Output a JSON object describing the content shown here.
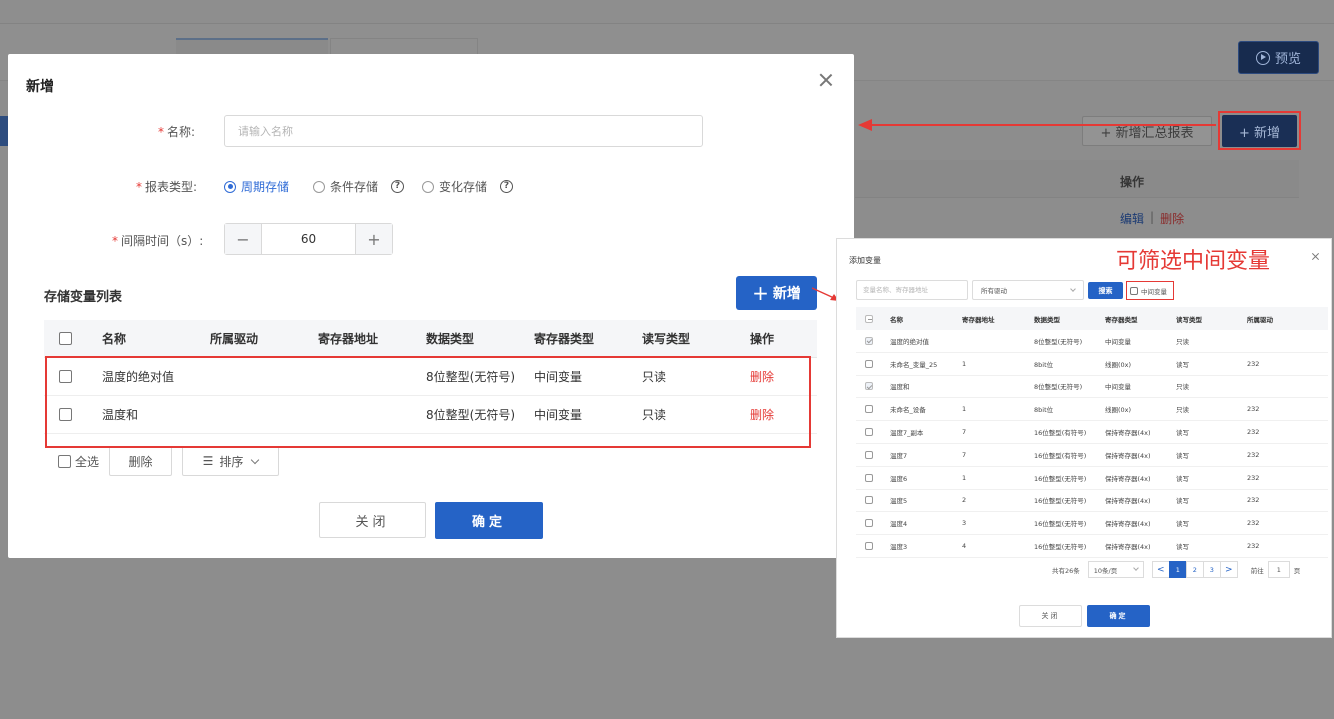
{
  "background": {
    "preview_button": "预览",
    "summary_button": "+ 新增汇总报表",
    "add_button": "+ 新增",
    "table_header_op": "操作",
    "row_edit": "编辑",
    "row_sep": "|",
    "row_delete": "删除"
  },
  "modal": {
    "title": "新增",
    "form": {
      "name_label": "名称:",
      "name_placeholder": "请输入名称",
      "type_label": "报表类型:",
      "type_options": [
        "周期存储",
        "条件存储",
        "变化存储"
      ],
      "type_selected": "周期存储",
      "help_icon_glyph": "?",
      "interval_label": "间隔时间（s）:",
      "interval_value": "60",
      "minus_glyph": "−",
      "plus_glyph": "+"
    },
    "var_section_title": "存储变量列表",
    "add_var_button": "新增",
    "table": {
      "headers": [
        "名称",
        "所属驱动",
        "寄存器地址",
        "数据类型",
        "寄存器类型",
        "读写类型",
        "操作"
      ],
      "rows": [
        {
          "name": "温度的绝对值",
          "driver": "",
          "address": "",
          "data_type": "8位整型(无符号)",
          "reg_type": "中间变量",
          "rw": "只读",
          "op": "删除"
        },
        {
          "name": "温度和",
          "driver": "",
          "address": "",
          "data_type": "8位整型(无符号)",
          "reg_type": "中间变量",
          "rw": "只读",
          "op": "删除"
        }
      ]
    },
    "batch": {
      "select_all": "全选",
      "delete": "删除",
      "sort": "排序"
    },
    "footer": {
      "close": "关闭",
      "ok": "确定"
    }
  },
  "panel": {
    "title": "添加变量",
    "callout": "可筛选中间变量",
    "search_placeholder": "变量名称、寄存器地址",
    "driver_select": "所有驱动",
    "search_button": "搜索",
    "mid_var_checkbox": "中间变量",
    "headers": [
      "名称",
      "寄存器地址",
      "数据类型",
      "寄存器类型",
      "读写类型",
      "所属驱动"
    ],
    "rows": [
      {
        "checked": true,
        "name": "温度的绝对值",
        "addr": "",
        "dt": "8位整型(无符号)",
        "rt": "中间变量",
        "rw": "只读",
        "drv": ""
      },
      {
        "checked": false,
        "name": "未命名_变量_25",
        "addr": "1",
        "dt": "8bit位",
        "rt": "线圈(0x)",
        "rw": "读写",
        "drv": "232"
      },
      {
        "checked": true,
        "name": "温度和",
        "addr": "",
        "dt": "8位整型(无符号)",
        "rt": "中间变量",
        "rw": "只读",
        "drv": ""
      },
      {
        "checked": false,
        "name": "未命名_设备",
        "addr": "1",
        "dt": "8bit位",
        "rt": "线圈(0x)",
        "rw": "只读",
        "drv": "232"
      },
      {
        "checked": false,
        "name": "温度7_副本",
        "addr": "7",
        "dt": "16位整型(有符号)",
        "rt": "保持寄存器(4x)",
        "rw": "读写",
        "drv": "232"
      },
      {
        "checked": false,
        "name": "温度7",
        "addr": "7",
        "dt": "16位整型(有符号)",
        "rt": "保持寄存器(4x)",
        "rw": "读写",
        "drv": "232"
      },
      {
        "checked": false,
        "name": "温度6",
        "addr": "1",
        "dt": "16位整型(无符号)",
        "rt": "保持寄存器(4x)",
        "rw": "读写",
        "drv": "232"
      },
      {
        "checked": false,
        "name": "温度5",
        "addr": "2",
        "dt": "16位整型(无符号)",
        "rt": "保持寄存器(4x)",
        "rw": "读写",
        "drv": "232"
      },
      {
        "checked": false,
        "name": "温度4",
        "addr": "3",
        "dt": "16位整型(无符号)",
        "rt": "保持寄存器(4x)",
        "rw": "读写",
        "drv": "232"
      },
      {
        "checked": false,
        "name": "温度3",
        "addr": "4",
        "dt": "16位整型(无符号)",
        "rt": "保持寄存器(4x)",
        "rw": "读写",
        "drv": "232"
      }
    ],
    "pager": {
      "total": "共有26条",
      "page_size": "10条/页",
      "prev": "<",
      "pages": [
        "1",
        "2",
        "3"
      ],
      "current": "1",
      "next": ">",
      "goto_label": "前往",
      "goto_value": "1",
      "goto_suffix": "页"
    },
    "footer": {
      "close": "关闭",
      "ok": "确定"
    }
  },
  "colors": {
    "primary": "#2563c6",
    "danger": "#e53935"
  }
}
